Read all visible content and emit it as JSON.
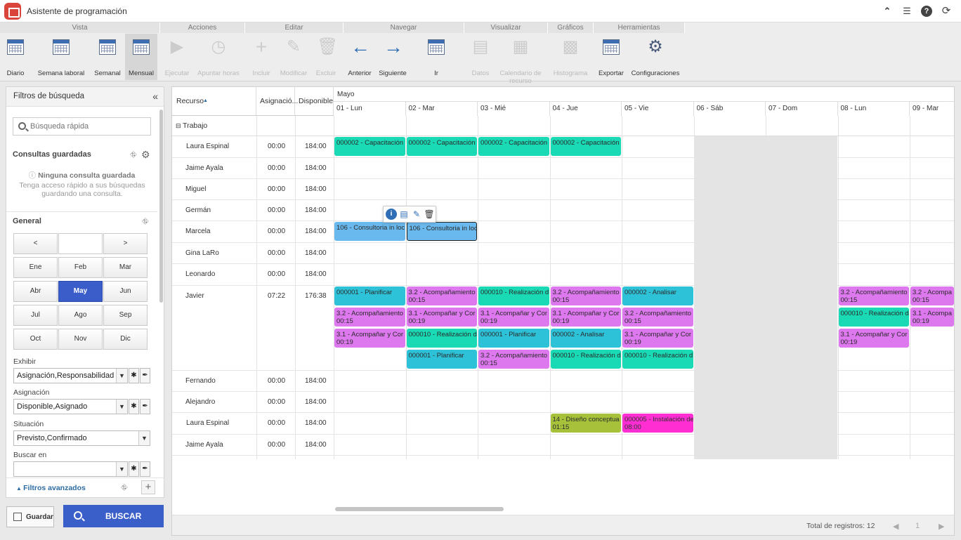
{
  "window": {
    "title": "Asistente de programación"
  },
  "ribbon": {
    "groups": [
      "Vista",
      "Acciones",
      "Editar",
      "Navegar",
      "Visualizar",
      "Gráficos",
      "Herramientas"
    ],
    "buttons": {
      "diario": "Diario",
      "semana_laboral": "Semana laboral",
      "semanal": "Semanal",
      "mensual": "Mensual",
      "ejecutar": "Ejecutar",
      "apuntar_horas": "Apuntar horas",
      "incluir": "Incluir",
      "modificar": "Modificar",
      "excluir": "Excluir",
      "anterior": "Anterior",
      "siguiente": "Siguiente",
      "ir": "Ir",
      "datos": "Datos",
      "calendario_recurso": "Calendario de recurso",
      "histograma": "Histograma",
      "exportar": "Exportar",
      "configuraciones": "Configuraciones"
    }
  },
  "sidebar": {
    "title": "Filtros de búsqueda",
    "quick_search_placeholder": "Búsqueda rápida",
    "saved_title": "Consultas guardadas",
    "no_saved": "Ninguna consulta guardada",
    "no_saved_desc": "Tenga acceso rápido a sus búsquedas guardando una consulta.",
    "general_title": "General",
    "prev": "<",
    "next": ">",
    "months": [
      "Ene",
      "Feb",
      "Mar",
      "Abr",
      "May",
      "Jun",
      "Jul",
      "Ago",
      "Sep",
      "Oct",
      "Nov",
      "Dic"
    ],
    "selected_month": "May",
    "exhibir_label": "Exhibir",
    "exhibir_value": "Asignación,Responsabilidad",
    "asignacion_label": "Asignación",
    "asignacion_value": "Disponible,Asignado",
    "situacion_label": "Situación",
    "situacion_value": "Previsto,Confirmado",
    "buscar_en_label": "Buscar en",
    "buscar_en_value": "",
    "advanced": "Filtros avanzados",
    "save_button": "Guardar",
    "search_button": "BUSCAR"
  },
  "grid": {
    "columns": {
      "recurso": "Recurso",
      "asignacion": "Asignació...",
      "disponible": "Disponible"
    },
    "month": "Mayo",
    "days": [
      "01 - Lun",
      "02 - Mar",
      "03 - Mié",
      "04 - Jue",
      "05 - Vie",
      "06 - Sáb",
      "07 - Dom",
      "08 - Lun",
      "09 - Mar"
    ],
    "section": "Trabajo",
    "rows": [
      {
        "name": "Laura Espinal",
        "asig": "00:00",
        "disp": "184:00"
      },
      {
        "name": "Jaime Ayala",
        "asig": "00:00",
        "disp": "184:00"
      },
      {
        "name": "Miguel",
        "asig": "00:00",
        "disp": "184:00"
      },
      {
        "name": "Germán",
        "asig": "00:00",
        "disp": "184:00"
      },
      {
        "name": "Marcela",
        "asig": "00:00",
        "disp": "184:00"
      },
      {
        "name": "Gina LaRo",
        "asig": "00:00",
        "disp": "184:00"
      },
      {
        "name": "Leonardo",
        "asig": "00:00",
        "disp": "184:00"
      },
      {
        "name": "Javier",
        "asig": "07:22",
        "disp": "176:38"
      },
      {
        "name": "Fernando",
        "asig": "00:00",
        "disp": "184:00"
      },
      {
        "name": "Alejandro",
        "asig": "00:00",
        "disp": "184:00"
      },
      {
        "name": "Laura Espinal",
        "asig": "00:00",
        "disp": "184:00"
      },
      {
        "name": "Jaime Ayala",
        "asig": "00:00",
        "disp": "184:00"
      }
    ],
    "events": {
      "laura_1": "000002 - Capacitación",
      "laura_2": "000002 - Capacitación",
      "laura_3": "000002 - Capacitación",
      "laura_4": "000002 - Capacitación",
      "marcela_1": "106 - Consultoria in loc",
      "marcela_2": "106 - Consultoria in loc",
      "j_1_1": "000001 - Planificar",
      "j_1_2": "3.2 - Acompañamiento",
      "j_1_2t": "00:15",
      "j_1_3": "000010 - Realización d",
      "j_1_4": "3.2 - Acompañamiento",
      "j_1_4t": "00:15",
      "j_1_5": "000002 - Analisar",
      "j_1_8": "3.2 - Acompañamiento",
      "j_1_8t": "00:15",
      "j_1_9": "3.2 - Acompa",
      "j_1_9t": "00:15",
      "j_2_1": "3.2 - Acompañamiento",
      "j_2_1t": "00:15",
      "j_2_2": "3.1 - Acompañar y Cor",
      "j_2_2t": "00:19",
      "j_2_3": "3.1 - Acompañar y Cor",
      "j_2_3t": "00:19",
      "j_2_4": "3.1 - Acompañar y Cor",
      "j_2_4t": "00:19",
      "j_2_5": "3.2 - Acompañamiento",
      "j_2_5t": "00:15",
      "j_2_8": "000010 - Realización d",
      "j_2_9": "3.1 - Acompa",
      "j_2_9t": "00:19",
      "j_3_1": "3.1 - Acompañar y Cor",
      "j_3_1t": "00:19",
      "j_3_2": "000010 - Realización d",
      "j_3_3": "000001 - Planificar",
      "j_3_4": "000002 - Analisar",
      "j_3_5": "3.1 - Acompañar y Cor",
      "j_3_5t": "00:19",
      "j_3_8": "3.1 - Acompañar y Cor",
      "j_3_8t": "00:19",
      "j_4_2": "000001 - Planificar",
      "j_4_3": "3.2 - Acompañamiento",
      "j_4_3t": "00:15",
      "j_4_4": "000010 - Realización d",
      "j_4_5": "000010 - Realización d",
      "l2_4": "14 - Diseño conceptua",
      "l2_4t": "01:15",
      "l2_5": "000005 - Instalación de",
      "l2_5t": "08:00"
    },
    "total": "Total de registros: 12",
    "page": "1",
    "sort_indicator": "▲"
  },
  "colors": {
    "accent": "#3b5fc8",
    "teal": "#1ad9b5",
    "cyan": "#2ec2d8",
    "purple": "#dd78ef",
    "blue": "#6ab9ee",
    "olive": "#a7c23a",
    "magenta": "#ff2ed2"
  }
}
